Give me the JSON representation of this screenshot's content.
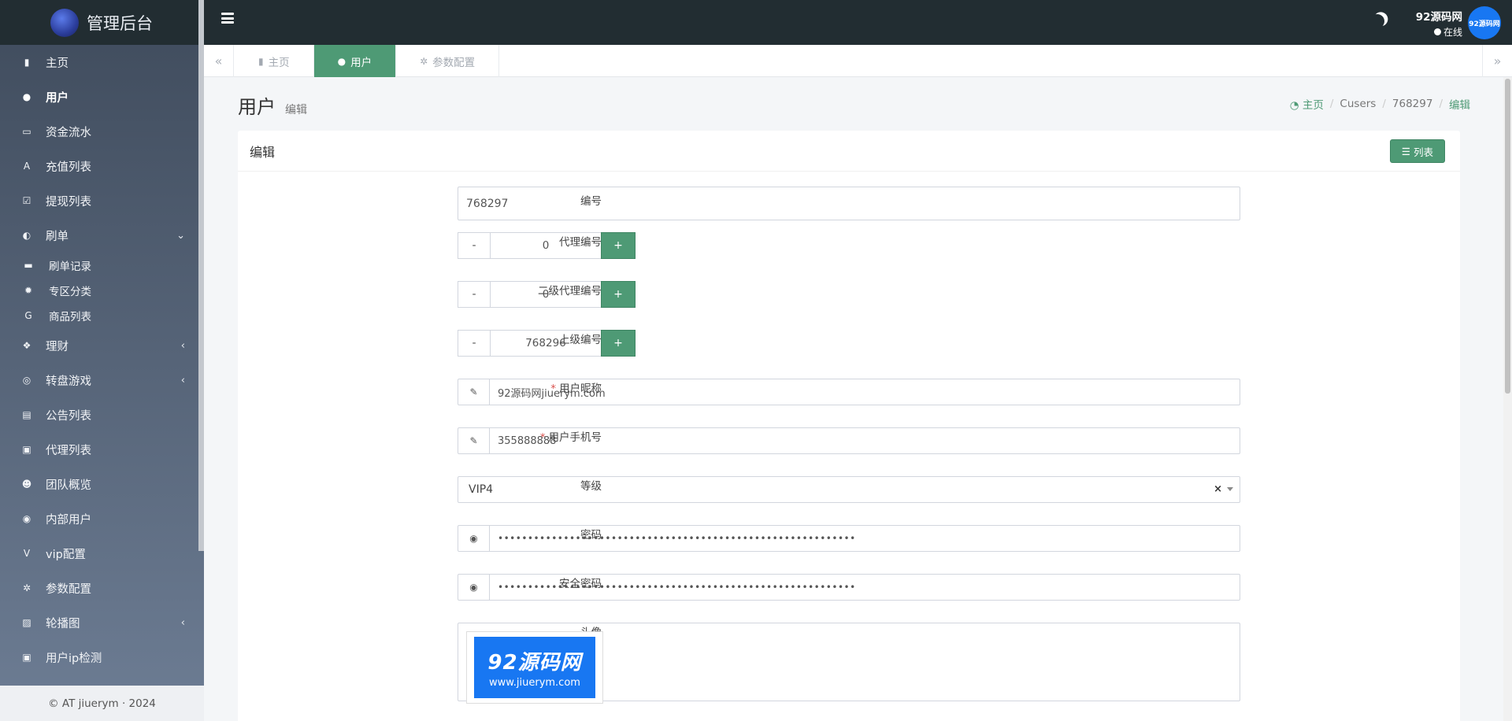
{
  "app": {
    "title": "管理后台",
    "footer": "© AT jiuerym · 2024"
  },
  "sidebar": {
    "items": [
      {
        "label": "主页",
        "icon": "bar-chart-icon"
      },
      {
        "label": "用户",
        "icon": "user-icon",
        "active": true
      },
      {
        "label": "资金流水",
        "icon": "money-icon"
      },
      {
        "label": "充值列表",
        "icon": "font-icon"
      },
      {
        "label": "提现列表",
        "icon": "check-square-icon"
      },
      {
        "label": "刷单",
        "icon": "adjust-icon",
        "caret": "⌄"
      },
      {
        "label": "刷单记录",
        "icon": "keyboard-icon",
        "sub": true
      },
      {
        "label": "专区分类",
        "icon": "gear-icon",
        "sub": true
      },
      {
        "label": "商品列表",
        "icon": "google-icon",
        "sub": true
      },
      {
        "label": "理财",
        "icon": "cubes-icon",
        "caret": "‹"
      },
      {
        "label": "转盘游戏",
        "icon": "gamepad-icon",
        "caret": "‹"
      },
      {
        "label": "公告列表",
        "icon": "file-text-icon"
      },
      {
        "label": "代理列表",
        "icon": "address-book-icon"
      },
      {
        "label": "团队概览",
        "icon": "users-icon"
      },
      {
        "label": "内部用户",
        "icon": "user-circle-icon"
      },
      {
        "label": "vip配置",
        "icon": "vimeo-icon"
      },
      {
        "label": "参数配置",
        "icon": "cogs-icon"
      },
      {
        "label": "轮播图",
        "icon": "image-icon",
        "caret": "‹"
      },
      {
        "label": "用户ip检测",
        "icon": "id-card-icon"
      }
    ]
  },
  "topbar": {
    "username": "92源码网",
    "status": "在线",
    "avatar_text": "92源码网"
  },
  "tabs": [
    {
      "label": "主页",
      "icon": "bar-chart-icon"
    },
    {
      "label": "用户",
      "icon": "user-icon",
      "active": true
    },
    {
      "label": "参数配置",
      "icon": "cogs-icon"
    }
  ],
  "page": {
    "title": "用户",
    "subtitle": "编辑",
    "breadcrumb": {
      "home": "主页",
      "items": [
        "Cusers",
        "768297"
      ],
      "current": "编辑"
    }
  },
  "card": {
    "title": "编辑",
    "list_button": "列表"
  },
  "form": {
    "id": {
      "label": "编号",
      "value": "768297"
    },
    "agent_id": {
      "label": "代理编号",
      "value": "0",
      "minus": "-",
      "plus": "+"
    },
    "agent2_id": {
      "label": "二级代理编号",
      "value": "0",
      "minus": "-",
      "plus": "+"
    },
    "parent_id": {
      "label": "上级编号",
      "value": "768296",
      "minus": "-",
      "plus": "+"
    },
    "nickname": {
      "label": "用户昵称",
      "required": "*",
      "value": "92源码网jiuerym.com"
    },
    "phone": {
      "label": "用户手机号",
      "required": "*",
      "value": "355888888"
    },
    "level": {
      "label": "等级",
      "value": "VIP4",
      "clear": "×"
    },
    "password": {
      "label": "密码",
      "value": "••••••••••••••••••••••••••••••••••••••••••••••••••••••••••••"
    },
    "safe_password": {
      "label": "安全密码",
      "value": "••••••••••••••••••••••••••••••••••••••••••••••••••••••••••••"
    },
    "avatar": {
      "label": "头像",
      "image_text": "92源码网",
      "image_url_text": "www.jiuerym.com"
    }
  },
  "colors": {
    "accent": "#4e9a75",
    "topbar": "#222d32",
    "avatar_blue": "#1877f2"
  }
}
